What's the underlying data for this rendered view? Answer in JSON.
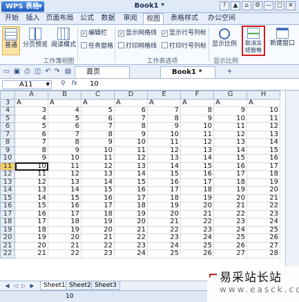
{
  "app": {
    "name": "WPS 表格",
    "window_title": "Book1 *"
  },
  "window_buttons": [
    "?",
    "▲",
    "⌂",
    "⚙",
    "—",
    "◻",
    "✕"
  ],
  "menu": [
    "开始",
    "插入",
    "页面布局",
    "公式",
    "数据",
    "审阅",
    "视图",
    "表格样式",
    "办公空间"
  ],
  "menu_active": "视图",
  "ribbon": {
    "buttons": [
      "普通",
      "分页预览",
      "阅读模式"
    ],
    "group1_checks": [
      {
        "label": "编辑栏",
        "checked": true
      },
      {
        "label": "任务窗格",
        "checked": false
      }
    ],
    "group2_checks": [
      {
        "label": "显示网格线",
        "checked": true
      },
      {
        "label": "显示行号列标",
        "checked": true
      },
      {
        "label": "打印网格线",
        "checked": false
      },
      {
        "label": "打印行号列标",
        "checked": false
      }
    ],
    "zoom_button": "显示比例",
    "freeze_button": "取消冻结窗格",
    "new_window_button": "新建窗口",
    "groups": [
      "工作簿视图",
      "工作表选项",
      "显示比例"
    ]
  },
  "toolbar": {
    "tabs": [
      "首页",
      "Book1 *"
    ]
  },
  "formula": {
    "cell": "A11",
    "fx": "fx",
    "value": "10"
  },
  "columns": [
    "A",
    "B",
    "C",
    "D",
    "E",
    "F",
    "G",
    "H"
  ],
  "rows": [
    {
      "n": "3",
      "cells": [
        "A",
        "A",
        "A",
        "A",
        "A",
        "A",
        "A",
        "A"
      ]
    },
    {
      "n": "4",
      "cells": [
        "3",
        "4",
        "5",
        "6",
        "7",
        "8",
        "9",
        "10"
      ]
    },
    {
      "n": "5",
      "cells": [
        "4",
        "5",
        "6",
        "7",
        "8",
        "9",
        "10",
        "11"
      ]
    },
    {
      "n": "6",
      "cells": [
        "5",
        "6",
        "7",
        "8",
        "9",
        "10",
        "11",
        "12"
      ]
    },
    {
      "n": "7",
      "cells": [
        "6",
        "7",
        "8",
        "9",
        "10",
        "11",
        "12",
        "13"
      ]
    },
    {
      "n": "8",
      "cells": [
        "7",
        "8",
        "9",
        "10",
        "11",
        "12",
        "13",
        "14"
      ]
    },
    {
      "n": "9",
      "cells": [
        "8",
        "9",
        "10",
        "11",
        "12",
        "13",
        "14",
        "15"
      ]
    },
    {
      "n": "10",
      "cells": [
        "9",
        "10",
        "11",
        "12",
        "13",
        "14",
        "15",
        "16"
      ]
    },
    {
      "n": "11",
      "cells": [
        "10",
        "11",
        "12",
        "13",
        "14",
        "15",
        "16",
        "17"
      ]
    },
    {
      "n": "12",
      "cells": [
        "11",
        "12",
        "13",
        "14",
        "15",
        "16",
        "17",
        "18"
      ]
    },
    {
      "n": "13",
      "cells": [
        "12",
        "13",
        "14",
        "15",
        "16",
        "17",
        "18",
        "19"
      ]
    },
    {
      "n": "14",
      "cells": [
        "13",
        "14",
        "15",
        "16",
        "17",
        "18",
        "19",
        "20"
      ]
    },
    {
      "n": "15",
      "cells": [
        "14",
        "15",
        "16",
        "17",
        "18",
        "19",
        "20",
        "21"
      ]
    },
    {
      "n": "16",
      "cells": [
        "15",
        "16",
        "17",
        "18",
        "19",
        "20",
        "21",
        "22"
      ]
    },
    {
      "n": "17",
      "cells": [
        "16",
        "17",
        "18",
        "19",
        "20",
        "21",
        "22",
        "23"
      ]
    },
    {
      "n": "18",
      "cells": [
        "17",
        "18",
        "19",
        "20",
        "21",
        "22",
        "23",
        "24"
      ]
    },
    {
      "n": "19",
      "cells": [
        "18",
        "19",
        "20",
        "21",
        "22",
        "23",
        "24",
        "25"
      ]
    },
    {
      "n": "20",
      "cells": [
        "19",
        "20",
        "21",
        "22",
        "23",
        "24",
        "25",
        "26"
      ]
    },
    {
      "n": "21",
      "cells": [
        "20",
        "21",
        "22",
        "23",
        "24",
        "25",
        "26",
        "27"
      ]
    },
    {
      "n": "22",
      "cells": [
        "21",
        "22",
        "23",
        "24",
        "25",
        "26",
        "27",
        "28"
      ]
    }
  ],
  "active_row": "11",
  "sheets": [
    "Sheet1",
    "Sheet2",
    "Sheet3"
  ],
  "status": {
    "value": "10"
  },
  "watermark": {
    "line1": "易采站长站",
    "line2": "www.easck.com"
  },
  "colors": {
    "accent": "#1f5fc2",
    "highlight_box": "#d11b1b",
    "active_row": "#f3cc6a"
  }
}
